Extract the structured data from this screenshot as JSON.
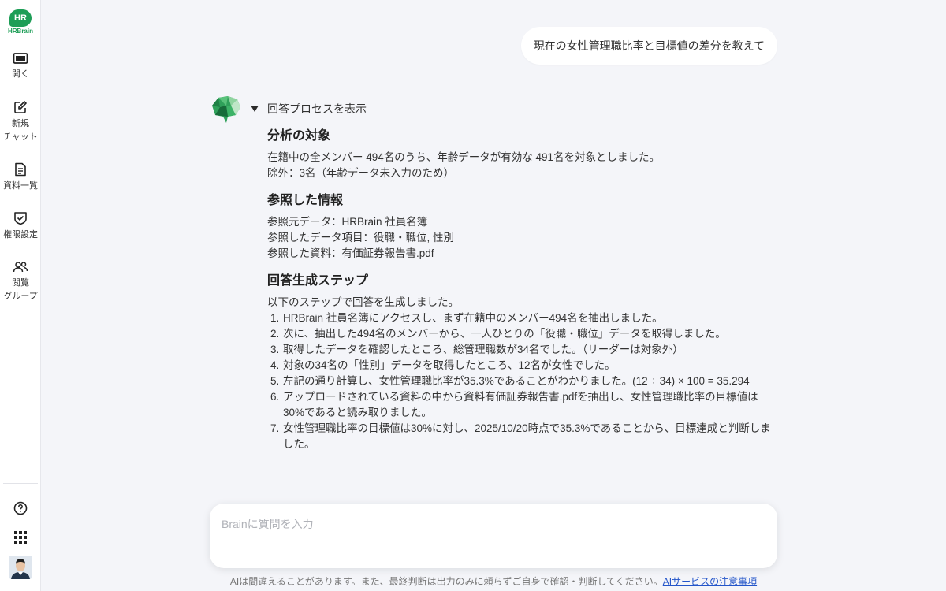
{
  "app": {
    "logo_text": "HRBrain",
    "logo_badge": "HR"
  },
  "sidebar": {
    "items": [
      {
        "id": "open",
        "label": "開く",
        "icon": "panel-icon"
      },
      {
        "id": "new-chat",
        "label": "新規\nチャット",
        "icon": "edit-icon"
      },
      {
        "id": "docs",
        "label": "資料一覧",
        "icon": "document-icon"
      },
      {
        "id": "permissions",
        "label": "権限設定",
        "icon": "shield-check-icon"
      },
      {
        "id": "groups",
        "label": "閲覧\nグループ",
        "icon": "users-icon"
      }
    ],
    "bottom": [
      {
        "id": "help",
        "icon": "help-icon"
      },
      {
        "id": "apps",
        "icon": "apps-grid-icon"
      }
    ]
  },
  "chat": {
    "user_message": "現在の女性管理職比率と目標値の差分を教えて",
    "process_toggle": "回答プロセスを表示",
    "sections": {
      "target": {
        "title": "分析の対象",
        "lines": [
          "在籍中の全メンバー 494名のうち、年齢データが有効な 491名を対象としました。",
          "除外：3名（年齢データ未入力のため）"
        ]
      },
      "refs": {
        "title": "参照した情報",
        "lines": [
          "参照元データ：HRBrain 社員名簿",
          "参照したデータ項目：役職・職位, 性別",
          "参照した資料：有価証券報告書.pdf"
        ]
      },
      "steps": {
        "title": "回答生成ステップ",
        "intro": "以下のステップで回答を生成しました。",
        "items": [
          "HRBrain 社員名簿にアクセスし、まず在籍中のメンバー494名を抽出しました。",
          "次に、抽出した494名のメンバーから、一人ひとりの「役職・職位」データを取得しました。",
          "取得したデータを確認したところ、総管理職数が34名でした。（リーダーは対象外）",
          "対象の34名の「性別」データを取得したところ、12名が女性でした。",
          "左記の通り計算し、女性管理職比率が35.3%であることがわかりました。(12 ÷ 34) × 100 = 35.294",
          "アップロードされている資料の中から資料有価証券報告書.pdfを抽出し、女性管理職比率の目標値は30%であると読み取りました。",
          "女性管理職比率の目標値は30%に対し、2025/10/20時点で35.3%であることから、目標達成と判断しました。"
        ]
      }
    }
  },
  "composer": {
    "placeholder": "Brainに質問を入力"
  },
  "footer": {
    "disclaimer": "AIは間違えることがあります。また、最終判断は出力のみに頼らずご自身で確認・判断してください。",
    "link": "AIサービスの注意事項"
  },
  "colors": {
    "brand": "#1e9e57",
    "link": "#2355c9",
    "background": "#f4f5f9"
  }
}
